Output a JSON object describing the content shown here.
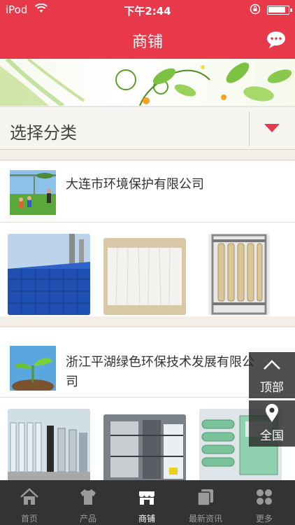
{
  "status_bar": {
    "carrier": "iPod",
    "time": "下午2:44"
  },
  "header": {
    "title": "商铺"
  },
  "category": {
    "label": "选择分类"
  },
  "shops": [
    {
      "name": "大连市环境保护有限公司"
    },
    {
      "name": "浙江平湖绿色环保技术发展有限公司"
    }
  ],
  "floating": {
    "top_label": "顶部",
    "all_label": "全国"
  },
  "tabs": [
    {
      "label": "首页",
      "icon": "home-icon"
    },
    {
      "label": "产品",
      "icon": "shirt-icon"
    },
    {
      "label": "商铺",
      "icon": "store-icon",
      "active": true
    },
    {
      "label": "最新资讯",
      "icon": "news-icon"
    },
    {
      "label": "更多",
      "icon": "grid-icon"
    }
  ],
  "colors": {
    "accent": "#e8394b",
    "tabbar": "#333333"
  }
}
